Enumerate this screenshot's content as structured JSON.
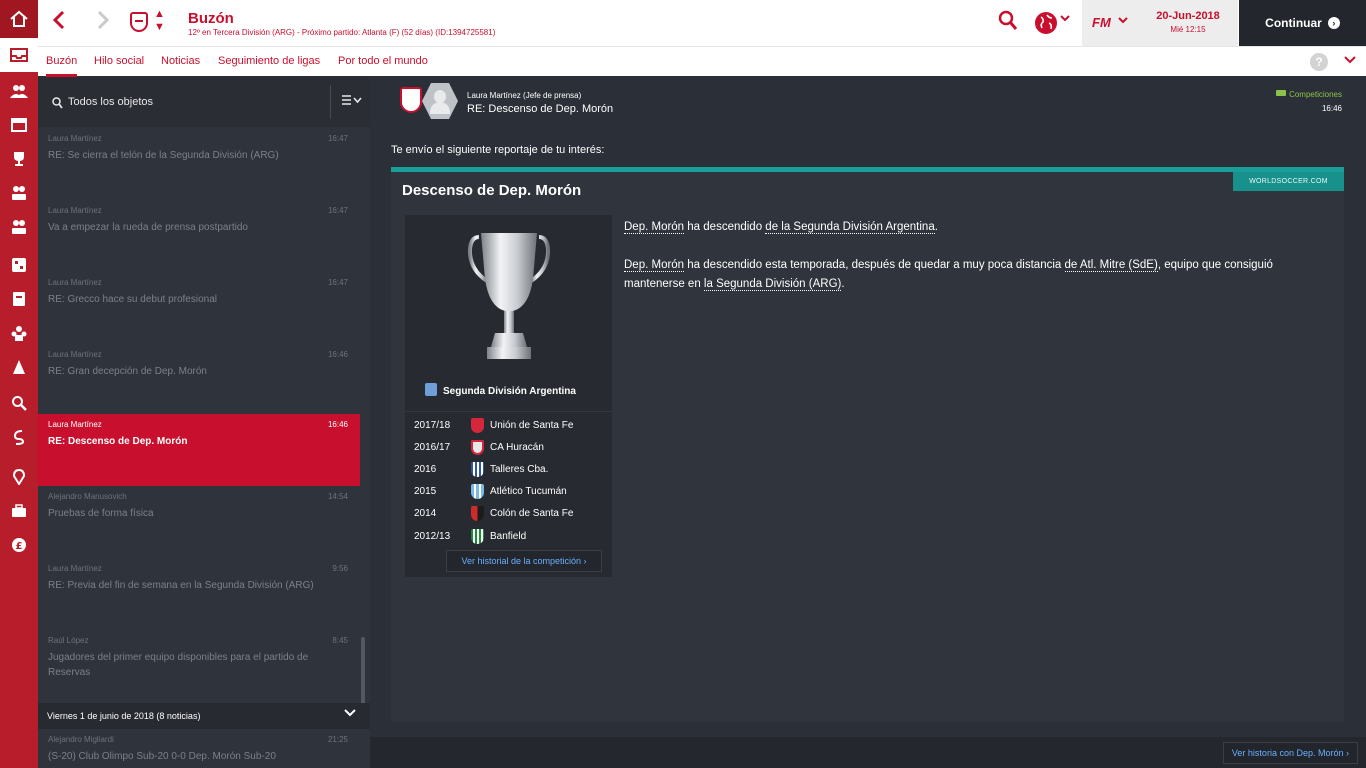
{
  "header": {
    "back_icon": "chevron-left-icon",
    "forward_icon": "chevron-right-icon",
    "title": "Buzón",
    "subtitle": "12º en Tercera División (ARG) - Próximo partido: Atlanta (F) (52 días) (ID:1394725581)",
    "search_icon": "search-icon",
    "globe_icon": "globe-icon",
    "fm_label": "FM",
    "date": "20-Jun-2018",
    "day_time": "Mié 12:15",
    "continue_label": "Continuar",
    "accent": "#c8102e"
  },
  "tabs": [
    {
      "label": "Buzón"
    },
    {
      "label": "Hilo social"
    },
    {
      "label": "Noticias"
    },
    {
      "label": "Seguimiento de ligas"
    },
    {
      "label": "Por todo el mundo"
    }
  ],
  "help_label": "?",
  "inbox": {
    "filter_label": "Todos los objetos",
    "messages": [
      {
        "sender": "Laura Martínez",
        "time": "16:47",
        "subject": "RE: Se cierra el telón de la Segunda División (ARG)"
      },
      {
        "sender": "Laura Martínez",
        "time": "16:47",
        "subject": "Va a empezar la rueda de prensa postpartido"
      },
      {
        "sender": "Laura Martínez",
        "time": "16:47",
        "subject": "RE: Grecco hace su debut profesional"
      },
      {
        "sender": "Laura Martínez",
        "time": "16:46",
        "subject": "RE: Gran decepción de Dep. Morón"
      },
      {
        "sender": "Laura Martínez",
        "time": "16:46",
        "subject": "RE: Descenso de Dep. Morón"
      },
      {
        "sender": "Alejandro Manusovich",
        "time": "14:54",
        "subject": "Pruebas de forma física"
      },
      {
        "sender": "Laura Martínez",
        "time": "9:56",
        "subject": "RE: Previa del fin de semana en la Segunda División (ARG)"
      },
      {
        "sender": "Raúl López",
        "time": "8:45",
        "subject": "Jugadores del primer equipo disponibles para el partido de Reservas"
      },
      {
        "sender": "Alejandro Migliardi",
        "time": "21:25",
        "subject": "(S-20) Club Olimpo Sub-20 0-0 Dep. Morón Sub-20"
      }
    ],
    "group_label": "Viernes 1 de junio de 2018 (8 noticias)"
  },
  "message": {
    "from": "Laura Martínez  (Jefe de prensa)",
    "subject": "RE: Descenso de Dep. Morón",
    "category": "Competiciones",
    "time": "16:46",
    "intro": "Te envío el siguiente reportaje de tu interés:"
  },
  "article": {
    "source": "WORLDSOCCER.COM",
    "title": "Descenso de Dep. Morón",
    "competition": "Segunda División Argentina",
    "winners": [
      {
        "year": "2017/18",
        "club": "Unión de Santa Fe",
        "color": "#d6263b"
      },
      {
        "year": "2016/17",
        "club": "CA Huracán",
        "color": "#e8e8e8"
      },
      {
        "year": "2016",
        "club": "Talleres Cba.",
        "color": "#2f56a6"
      },
      {
        "year": "2015",
        "club": "Atlético Tucumán",
        "color": "#7ab8e6"
      },
      {
        "year": "2014",
        "club": "Colón de Santa Fe",
        "color": "#cf2a2a"
      },
      {
        "year": "2012/13",
        "club": "Banfield",
        "color": "#1f8a3a"
      }
    ],
    "history_button": "Ver historial de la competición",
    "p1_a": "Dep. Morón",
    "p1_b": " ha descendido ",
    "p1_c": "de la Segunda División Argentina",
    "p1_d": ".",
    "p2_a": "Dep. Morón",
    "p2_b": " ha descendido esta temporada, después de quedar a muy poca distancia ",
    "p2_c": "de Atl. Mitre (SdE)",
    "p2_d": ", equipo que consiguió mantenerse en ",
    "p2_e": "la Segunda División (ARG)",
    "p2_f": "."
  },
  "footer_button": "Ver historia con Dep. Morón"
}
